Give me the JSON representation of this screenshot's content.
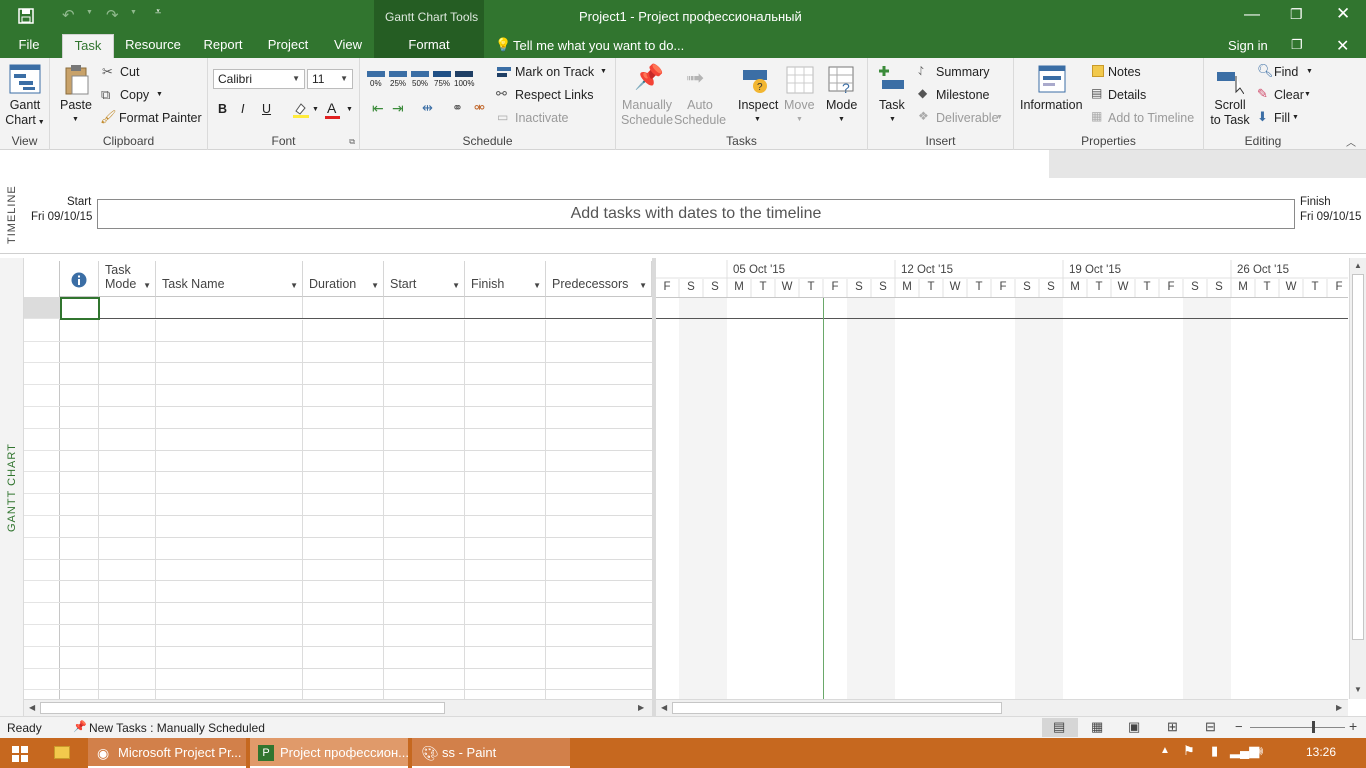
{
  "window": {
    "contextual_tab_group": "Gantt Chart Tools",
    "title": "Project1 - Project профессиональный",
    "sign_in": "Sign in"
  },
  "tabs": [
    {
      "label": "File"
    },
    {
      "label": "Task"
    },
    {
      "label": "Resource"
    },
    {
      "label": "Report"
    },
    {
      "label": "Project"
    },
    {
      "label": "View"
    },
    {
      "label": "Format"
    }
  ],
  "tell_me": "Tell me what you want to do...",
  "ribbon": {
    "view": {
      "gantt_chart": "Gantt",
      "gantt_chart2": "Chart",
      "label": "View"
    },
    "clipboard": {
      "paste": "Paste",
      "cut": "Cut",
      "copy": "Copy",
      "format_painter": "Format Painter",
      "label": "Clipboard"
    },
    "font": {
      "font_name": "Calibri",
      "font_size": "11",
      "bold": "B",
      "italic": "I",
      "underline": "U",
      "font_color": "A",
      "label": "Font"
    },
    "schedule": {
      "percent": [
        "0%",
        "25%",
        "50%",
        "75%",
        "100%"
      ],
      "mark_on_track": "Mark on Track",
      "respect_links": "Respect Links",
      "inactivate": "Inactivate",
      "label": "Schedule"
    },
    "tasks": {
      "manually": "Manually",
      "manually2": "Schedule",
      "auto": "Auto",
      "auto2": "Schedule",
      "inspect": "Inspect",
      "move": "Move",
      "mode": "Mode",
      "label": "Tasks"
    },
    "insert": {
      "task": "Task",
      "summary": "Summary",
      "milestone": "Milestone",
      "deliverable": "Deliverable",
      "label": "Insert"
    },
    "properties": {
      "information": "Information",
      "notes": "Notes",
      "details": "Details",
      "add_to_timeline": "Add to Timeline",
      "label": "Properties"
    },
    "editing": {
      "scroll": "Scroll",
      "scroll2": "to Task",
      "find": "Find",
      "clear": "Clear",
      "fill": "Fill",
      "label": "Editing"
    }
  },
  "timeline": {
    "side_label": "TIMELINE",
    "start_label": "Start",
    "start_date": "Fri 09/10/15",
    "finish_label": "Finish",
    "finish_date": "Fri 09/10/15",
    "placeholder": "Add tasks with dates to the timeline"
  },
  "gantt_side_label": "GANTT CHART",
  "columns": [
    {
      "label": "Task\nMode"
    },
    {
      "label": "Task Name"
    },
    {
      "label": "Duration"
    },
    {
      "label": "Start"
    },
    {
      "label": "Finish"
    },
    {
      "label": "Predecessors"
    }
  ],
  "weeks": [
    "05 Oct '15",
    "12 Oct '15",
    "19 Oct '15",
    "26 Oct '15"
  ],
  "days": [
    "F",
    "S",
    "S",
    "M",
    "T",
    "W",
    "T",
    "F",
    "S",
    "S",
    "M",
    "T",
    "W",
    "T",
    "F",
    "S",
    "S",
    "M",
    "T",
    "W",
    "T",
    "F",
    "S",
    "S",
    "M",
    "T",
    "W",
    "T",
    "F"
  ],
  "status": {
    "ready": "Ready",
    "new_tasks": "New Tasks : Manually Scheduled"
  },
  "taskbar": {
    "items": [
      "Microsoft Project Pr...",
      "Project профессион...",
      "ss - Paint"
    ],
    "clock": "13:26"
  },
  "colors": {
    "accent": "#31752f",
    "taskbar": "#c6681f"
  }
}
